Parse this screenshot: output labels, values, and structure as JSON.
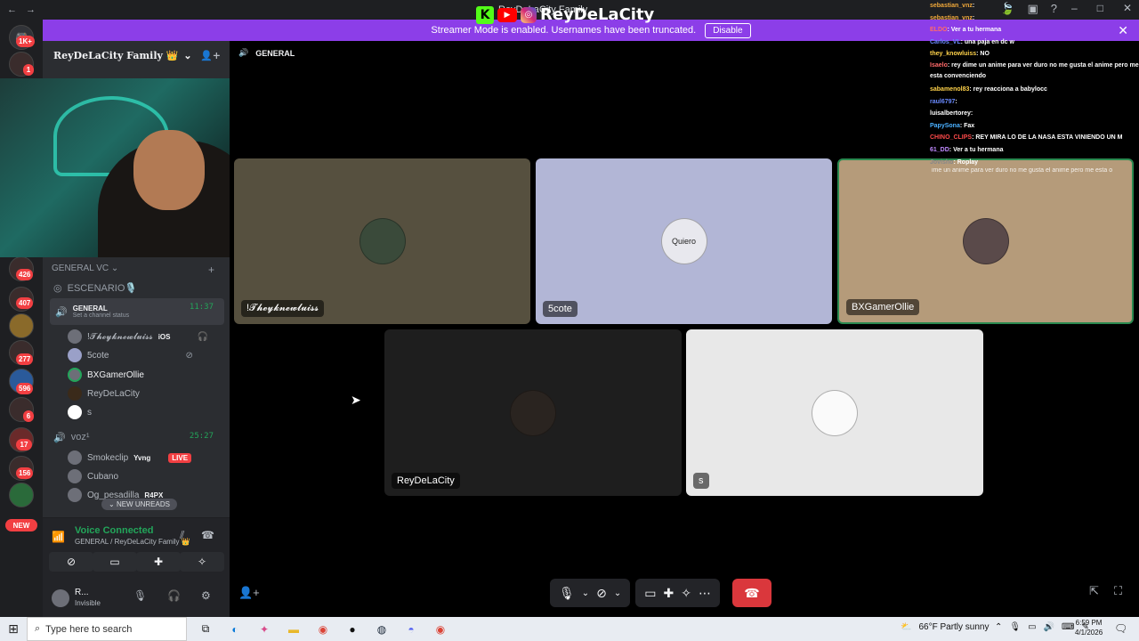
{
  "titlebar": {
    "title": "ReyDeLaCity Family"
  },
  "banner": {
    "text": "Streamer Mode is enabled. Usernames have been truncated.",
    "disable_label": "Disable"
  },
  "logo": {
    "text": "ReyDeLaCity"
  },
  "server": {
    "name": "ReyDeLaCity Family 👑"
  },
  "rail_badges": [
    "1K+",
    "1",
    "426",
    "407",
    "277",
    "596",
    "6",
    "17",
    "156",
    "NEW"
  ],
  "sidebar": {
    "category": "GENERAL VC",
    "channels": [
      {
        "label": "ESCENARIO🎙️"
      },
      {
        "label": "GENERAL",
        "timer": "11:37",
        "status": "Set a channel status"
      }
    ],
    "members": [
      {
        "name": "!𝓣𝓱𝓮𝔂𝓴𝓷𝓮𝔀𝓵𝓾𝓲𝓼𝓼",
        "tag": "iOS"
      },
      {
        "name": "5cote"
      },
      {
        "name": "BXGamerOllie"
      },
      {
        "name": "ReyDeLaCity"
      },
      {
        "name": "s"
      }
    ],
    "voz": {
      "label": "voz¹",
      "timer": "25:27"
    },
    "voz_members": [
      {
        "name": "Smokeclip",
        "tag": "Yvng",
        "live": "LIVE"
      },
      {
        "name": "Cubano"
      },
      {
        "name": "Og_pesadilla",
        "tag": "R4PX"
      }
    ],
    "new_unreads": "NEW UNREADS"
  },
  "voice": {
    "status": "Voice Connected",
    "sub": "GENERAL / ReyDeLaCity Family 👑"
  },
  "user": {
    "name": "R...",
    "status": "Invisible"
  },
  "main": {
    "channel": "GENERAL"
  },
  "tiles": [
    {
      "label": "!𝓣𝓱𝓮𝔂𝓴𝓷𝓮𝔀𝓵𝓾𝓲𝓼𝓼"
    },
    {
      "label": "5cote",
      "pfp_text": "Quiero"
    },
    {
      "label": "BXGamerOllie",
      "comment": "ime un anime para ver duro no me gusta el anime pero me esta o"
    },
    {
      "label": "ReyDeLaCity"
    },
    {
      "label": "s"
    }
  ],
  "chat": [
    {
      "user": "sebastian_vnz",
      "msg": ""
    },
    {
      "user": "sebastian_vnz",
      "msg": ""
    },
    {
      "user": "ELDO",
      "msg": "Ver a tu hermana"
    },
    {
      "user": "Carlos_VL",
      "msg": "una paja en dc w"
    },
    {
      "user": "they_knowluiss",
      "msg": "NO"
    },
    {
      "user": "Isaelo",
      "msg": "rey dime un anime para ver duro no me gusta el anime pero me esta convenciendo"
    },
    {
      "user": "sabamenol83",
      "msg": "rey reacciona a babylocc"
    },
    {
      "user": "raul6797",
      "msg": ""
    },
    {
      "user": "luisalbertorey",
      "msg": ""
    },
    {
      "user": "PapySona",
      "msg": "Fax"
    },
    {
      "user": "CHINO_CLIPS",
      "msg": "REY MIRA LO DE LA NASA ESTA VINIENDO UN M"
    },
    {
      "user": "61_DD",
      "msg": "Ver a tu hermana"
    },
    {
      "user": "Jovisho",
      "msg": "Roplay"
    }
  ],
  "taskbar": {
    "search_placeholder": "Type here to search",
    "weather": "66°F  Partly sunny",
    "time": "6:59 PM",
    "date": "4/1/2026"
  },
  "colors": {
    "accent": "#8c3ee8",
    "hangup": "#da373c",
    "connected": "#23a55a",
    "live": "#f23f42"
  }
}
